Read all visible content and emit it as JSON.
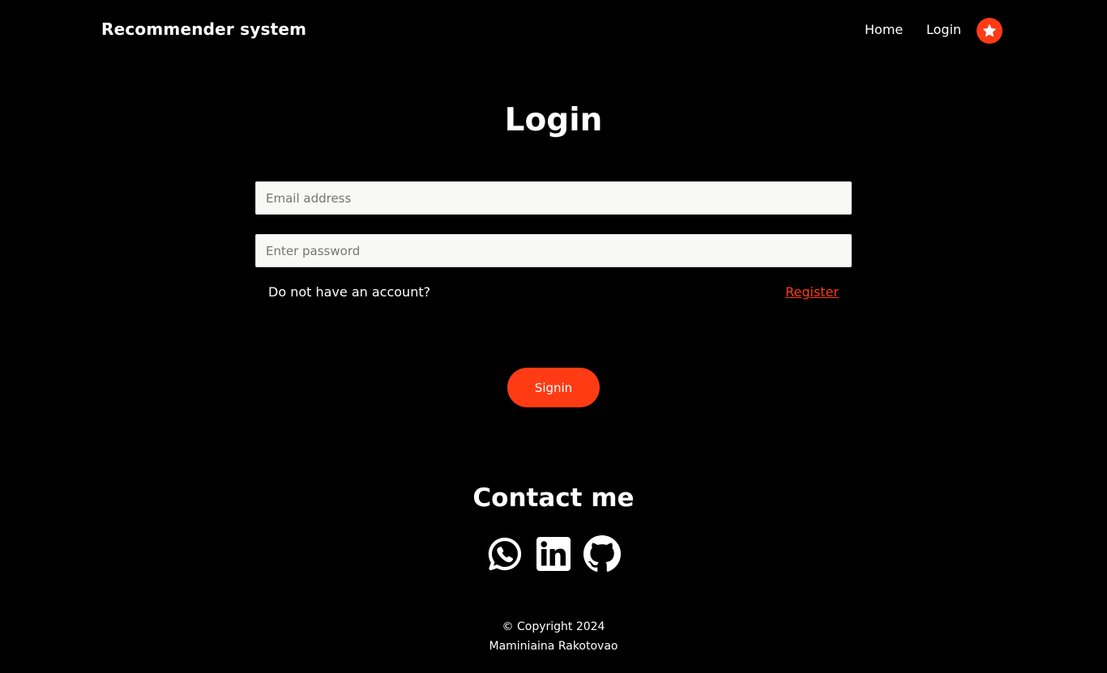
{
  "navbar": {
    "brand": "Recommender system",
    "links": [
      {
        "label": "Home"
      },
      {
        "label": "Login"
      }
    ],
    "favorite_icon": "star-icon"
  },
  "login": {
    "title": "Login",
    "email_placeholder": "Email address",
    "email_value": "",
    "password_placeholder": "Enter password",
    "password_value": "",
    "account_prompt": "Do not have an account?",
    "register_label": "Register",
    "signin_label": "Signin"
  },
  "contact": {
    "title": "Contact me",
    "icons": [
      "whatsapp-icon",
      "linkedin-icon",
      "github-icon"
    ]
  },
  "footer": {
    "copyright": "© Copyright 2024",
    "author": "Maminiaina Rakotovao"
  },
  "colors": {
    "accent": "#ff3b14",
    "background": "#000000",
    "input_background": "#f8f8f6"
  }
}
